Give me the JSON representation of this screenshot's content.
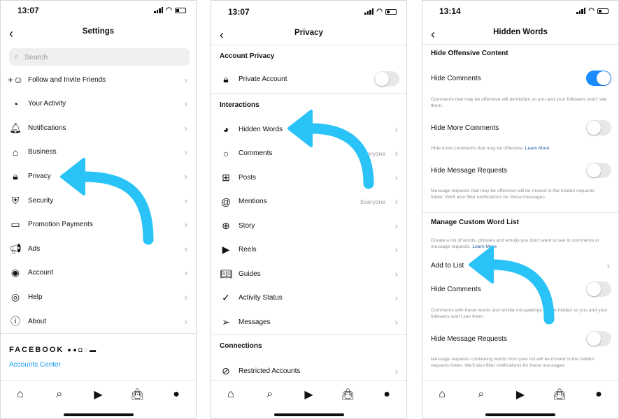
{
  "accent": "#29c3f7",
  "settings": {
    "time": "13:07",
    "title": "Settings",
    "search_placeholder": "Search",
    "items": [
      {
        "label": "Follow and Invite Friends",
        "icon": "add-person-icon"
      },
      {
        "label": "Your Activity",
        "icon": "activity-icon"
      },
      {
        "label": "Notifications",
        "icon": "bell-icon"
      },
      {
        "label": "Business",
        "icon": "store-icon"
      },
      {
        "label": "Privacy",
        "icon": "lock-icon"
      },
      {
        "label": "Security",
        "icon": "shield-icon"
      },
      {
        "label": "Promotion Payments",
        "icon": "card-icon"
      },
      {
        "label": "Ads",
        "icon": "megaphone-icon"
      },
      {
        "label": "Account",
        "icon": "account-icon"
      },
      {
        "label": "Help",
        "icon": "lifebuoy-icon"
      },
      {
        "label": "About",
        "icon": "info-icon"
      }
    ],
    "facebook": "FACEBOOK",
    "accounts_center": "Accounts Center"
  },
  "privacy": {
    "time": "13:07",
    "title": "Privacy",
    "account_privacy": "Account Privacy",
    "private_account": "Private Account",
    "private_on": false,
    "interactions": "Interactions",
    "items": [
      {
        "label": "Hidden Words",
        "icon": "eye-icon",
        "value": ""
      },
      {
        "label": "Comments",
        "icon": "comment-icon",
        "value": "Everyone"
      },
      {
        "label": "Posts",
        "icon": "plus-square-icon",
        "value": ""
      },
      {
        "label": "Mentions",
        "icon": "at-icon",
        "value": "Everyone"
      },
      {
        "label": "Story",
        "icon": "story-icon",
        "value": ""
      },
      {
        "label": "Reels",
        "icon": "reels-icon",
        "value": ""
      },
      {
        "label": "Guides",
        "icon": "guides-icon",
        "value": ""
      },
      {
        "label": "Activity Status",
        "icon": "activity-status-icon",
        "value": ""
      },
      {
        "label": "Messages",
        "icon": "send-icon",
        "value": ""
      }
    ],
    "connections": "Connections",
    "restricted": "Restricted Accounts"
  },
  "hidden": {
    "time": "13:14",
    "title": "Hidden Words",
    "offensive_title": "Hide Offensive Content",
    "hide_comments": "Hide Comments",
    "hide_comments_on": true,
    "hide_comments_desc": "Comments that may be offensive will be hidden so you and your followers won't see them.",
    "hide_more": "Hide More Comments",
    "hide_more_on": false,
    "hide_more_desc": "Hide more comments that may be offensive.",
    "learn_more": "Learn More",
    "hide_msg": "Hide Message Requests",
    "hide_msg_on": false,
    "hide_msg_desc": "Message requests that may be offensive will be moved to the hidden requests folder. We'll also filter notifications for these messages.",
    "custom_title": "Manage Custom Word List",
    "custom_desc": "Create a list of words, phrases and emojis you don't want to see in comments or message requests.",
    "add_to_list": "Add to List",
    "custom_hide_comments": "Hide Comments",
    "custom_hide_comments_on": false,
    "custom_hide_comments_desc": "Comments with these words and similar misspellings will be hidden so you and your followers won't see them.",
    "custom_hide_msg": "Hide Message Requests",
    "custom_hide_msg_on": false,
    "custom_hide_msg_desc": "Message requests containing words from your list will be moved to the hidden requests folder. We'll also filter notifications for these messages."
  },
  "nav": [
    {
      "icon": "home-icon"
    },
    {
      "icon": "search-icon"
    },
    {
      "icon": "reels-icon"
    },
    {
      "icon": "shop-icon"
    },
    {
      "icon": "profile-icon"
    }
  ]
}
